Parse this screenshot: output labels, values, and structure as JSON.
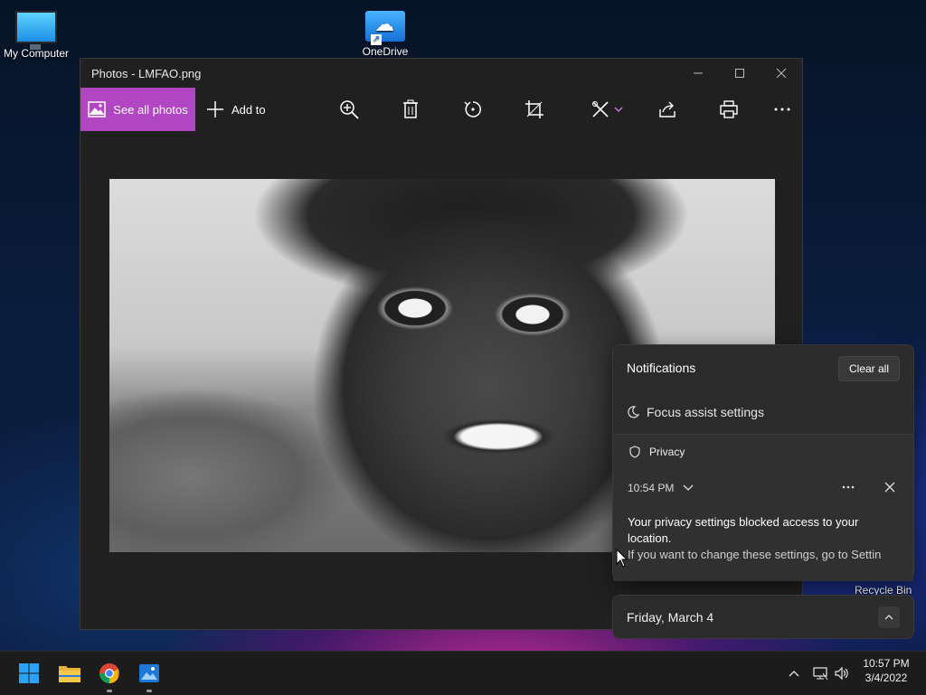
{
  "desktop": {
    "icons": [
      {
        "label": "My Computer",
        "icon": "computer-icon"
      },
      {
        "label": "OneDrive",
        "icon": "onedrive-icon"
      },
      {
        "label": "Recycle Bin",
        "icon": "recycle-bin-icon"
      }
    ]
  },
  "photos_window": {
    "title": "Photos - LMFAO.png",
    "toolbar": {
      "see_all_photos": "See all photos",
      "add_to": "Add to",
      "tools": [
        "zoom-in-icon",
        "delete-icon",
        "rotate-icon",
        "crop-icon",
        "edit-icon",
        "share-icon",
        "print-icon",
        "more-icon"
      ]
    },
    "accent_color": "#b146c2"
  },
  "notifications": {
    "header": "Notifications",
    "clear_all": "Clear all",
    "focus_assist": "Focus assist settings",
    "card": {
      "app": "Privacy",
      "time": "10:54 PM",
      "title": "Your privacy settings blocked access to your location.",
      "body": "If you want to change these settings, go to Settin"
    }
  },
  "calendar": {
    "date": "Friday, March 4"
  },
  "taskbar": {
    "apps": [
      "windows-start-icon",
      "file-explorer-icon",
      "chrome-icon",
      "photos-icon"
    ],
    "tray": [
      "chevron-up-icon",
      "network-icon",
      "volume-icon"
    ],
    "time": "10:57 PM",
    "date": "3/4/2022"
  }
}
